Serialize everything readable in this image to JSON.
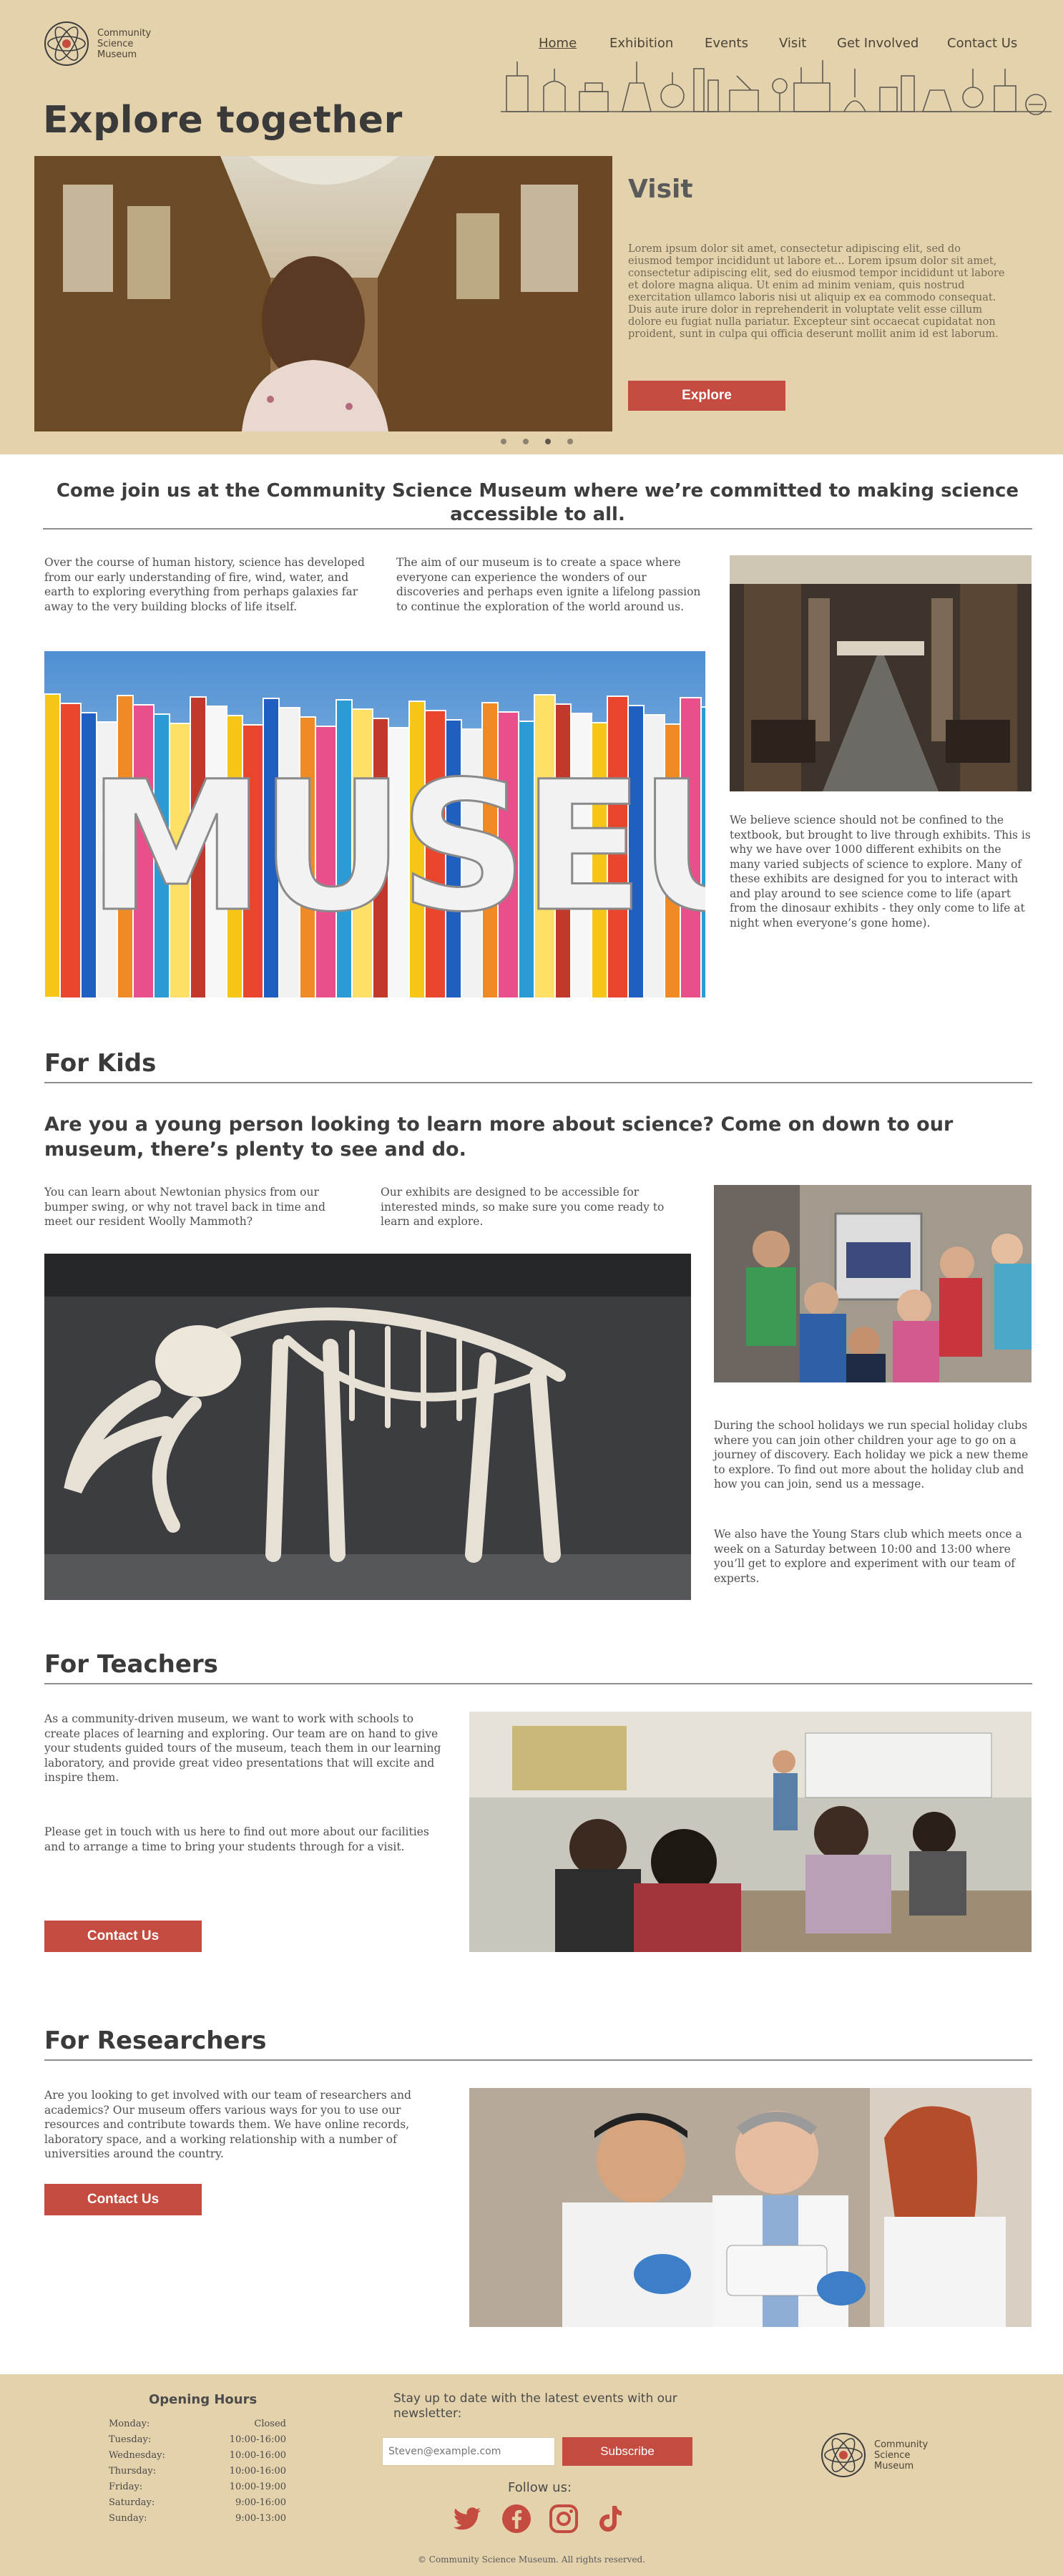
{
  "brand": {
    "name_line1": "Community",
    "name_line2": "Science",
    "name_line3": "Museum"
  },
  "nav": {
    "items": [
      {
        "label": "Home",
        "active": true
      },
      {
        "label": "Exhibition"
      },
      {
        "label": "Events"
      },
      {
        "label": "Visit"
      },
      {
        "label": "Get Involved"
      },
      {
        "label": "Contact Us"
      }
    ]
  },
  "hero": {
    "title": "Explore together",
    "slide_title": "Visit",
    "slide_text": "Lorem ipsum dolor sit amet, consectetur adipiscing elit, sed do eiusmod tempor incididunt ut labore et... Lorem ipsum dolor sit amet, consectetur adipiscing elit, sed do eiusmod tempor incididunt ut labore et dolore magna aliqua. Ut enim ad minim veniam, quis nostrud exercitation ullamco laboris nisi ut aliquip ex ea commodo consequat. Duis aute irure dolor in reprehenderit in voluptate velit esse cillum dolore eu fugiat nulla pariatur. Excepteur sint occaecat cupidatat non proident, sunt in culpa qui officia deserunt mollit anim id est laborum.",
    "button": "Explore",
    "slide_count": 4,
    "active_slide": 3
  },
  "intro": {
    "heading": "Come join us at the Community Science Museum where we’re committed to making science accessible to all.",
    "para1": "Over the course of human history, science has developed from our early understanding of fire, wind, water, and earth to exploring everything from perhaps galaxies far away to the very building blocks of life itself.",
    "para2": "The aim of our museum is to create a space where everyone can experience the wonders of our discoveries and perhaps even ignite a lifelong passion to continue the exploration of the world around us.",
    "para3": "We believe science should not be confined to the textbook, but brought to live through exhibits. This is why we have over 1000 different exhibits on the many varied subjects of science to explore. Many of these exhibits are designed for you to interact with and play around to see science come to life (apart from the dinosaur exhibits - they only come to life at night when everyone’s gone home).",
    "sign_letters": "MUSEUM"
  },
  "kids": {
    "title": "For Kids",
    "heading": "Are you a young person looking to learn more about science? Come on down to our museum, there’s plenty to see and do.",
    "para1": "You can learn about Newtonian physics from our bumper swing, or why not travel back in time and meet our resident Woolly Mammoth?",
    "para2": "Our exhibits are designed to be accessible for interested minds, so make sure you come ready to learn and explore.",
    "para3": "During the school holidays we run special holiday clubs where you can join other children your age to go on a journey of discovery. Each holiday we pick a new theme to explore. To find out more about the holiday club and how you can join, send us a message.",
    "para4": "We also have the Young Stars club which meets once a week on a Saturday between 10:00 and 13:00 where you’ll get to explore and experiment with our team of experts."
  },
  "teachers": {
    "title": "For Teachers",
    "para1": "As a community-driven museum, we want to work with schools to create places of learning and exploring. Our team are on hand to give your students guided tours of the museum, teach them in our learning laboratory, and provide great video presentations that will excite and inspire them.",
    "para2": "Please get in touch with us here to find out more about our facilities and to arrange a time to bring your students through for a visit.",
    "button": "Contact Us"
  },
  "researchers": {
    "title": "For Researchers",
    "para1": "Are you looking to get involved with our team of researchers and academics? Our museum offers various ways for you to use our resources and contribute towards them. We have online records, laboratory space, and a working relationship with a number of universities around the country.",
    "button": "Contact Us"
  },
  "footer": {
    "hours_title": "Opening Hours",
    "hours": [
      {
        "day": "Monday:",
        "time": "Closed"
      },
      {
        "day": "Tuesday:",
        "time": "10:00-16:00"
      },
      {
        "day": "Wednesday:",
        "time": "10:00-16:00"
      },
      {
        "day": "Thursday:",
        "time": "10:00-16:00"
      },
      {
        "day": "Friday:",
        "time": "10:00-19:00"
      },
      {
        "day": "Saturday:",
        "time": "9:00-16:00"
      },
      {
        "day": "Sunday:",
        "time": "9:00-13:00"
      }
    ],
    "newsletter_text": "Stay up to date with the latest events with our newsletter:",
    "email_placeholder": "Steven@example.com",
    "subscribe": "Subscribe",
    "follow": "Follow us:",
    "social": [
      "twitter-icon",
      "facebook-icon",
      "instagram-icon",
      "tiktok-icon"
    ],
    "copyright": "© Community Science Museum. All rights reserved."
  },
  "colors": {
    "sand": "#e4d2ac",
    "accent_red": "#c44b3f",
    "text": "#3b3b3b"
  }
}
